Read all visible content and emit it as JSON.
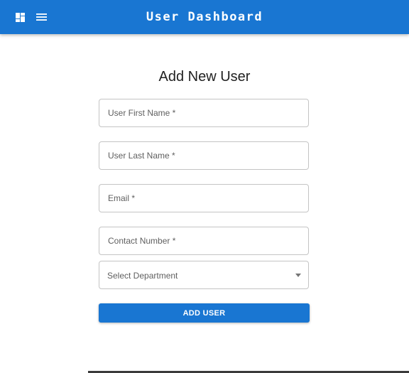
{
  "header": {
    "title": "User Dashboard",
    "dashboard_icon": "dashboard-icon",
    "menu_icon": "menu-icon"
  },
  "form": {
    "title": "Add New User",
    "fields": {
      "first_name": {
        "label": "User First Name *",
        "value": ""
      },
      "last_name": {
        "label": "User Last Name *",
        "value": ""
      },
      "email": {
        "label": "Email *",
        "value": ""
      },
      "contact": {
        "label": "Contact Number *",
        "value": ""
      },
      "department": {
        "label": "Select Department",
        "value": ""
      }
    },
    "submit_label": "ADD USER"
  },
  "colors": {
    "primary": "#1976d2",
    "border": "#c4c4c4",
    "label": "#5f5f5f"
  }
}
